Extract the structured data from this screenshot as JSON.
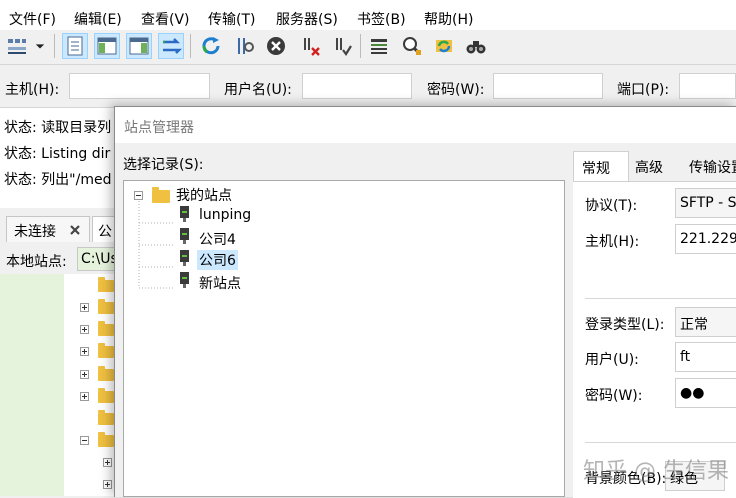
{
  "menu": [
    {
      "label": "文件(F)"
    },
    {
      "label": "编辑(E)"
    },
    {
      "label": "查看(V)"
    },
    {
      "label": "传输(T)"
    },
    {
      "label": "服务器(S)"
    },
    {
      "label": "书签(B)"
    },
    {
      "label": "帮助(H)"
    }
  ],
  "toolbar_icons": [
    "site-manager-icon",
    "dropdown-arrow-icon",
    "toggle-log-icon",
    "toggle-local-tree-icon",
    "toggle-remote-tree-icon",
    "toggle-transfer-queue-icon",
    "refresh-icon",
    "process-queue-icon",
    "cancel-icon",
    "disconnect-icon",
    "reconnect-icon",
    "filter-icon",
    "toggle-compare-icon",
    "search-icon",
    "sync-browse-icon",
    "find-files-icon"
  ],
  "quickconnect": {
    "host_label": "主机(H):",
    "user_label": "用户名(U):",
    "pass_label": "密码(W):",
    "port_label": "端口(P):"
  },
  "log": {
    "lines": [
      "状态:  读取目录列",
      "状态:  Listing dir",
      "状态:  列出\"/med"
    ]
  },
  "tabs": {
    "tab1": "未连接",
    "tab2": "公"
  },
  "local": {
    "label": "本地站点:",
    "path": "C:\\Us"
  },
  "dialog": {
    "title": "站点管理器",
    "select_label": "选择记录(S):",
    "tree_root": "我的站点",
    "sites": [
      "lunping",
      "公司4",
      "公司6",
      "新站点"
    ],
    "tabs": [
      "常规",
      "高级",
      "传输设置"
    ],
    "fields": {
      "protocol_label": "协议(T):",
      "protocol_value": "SFTP - S",
      "host_label": "主机(H):",
      "host_value": "221.229",
      "logontype_label": "登录类型(L):",
      "logontype_value": "正常",
      "user_label": "用户(U):",
      "user_value": "ft",
      "password_label": "密码(W):",
      "password_value": "●●",
      "bg_label": "背景颜色(B):",
      "bg_value": "绿色"
    }
  },
  "watermark": "知乎 @ 生信果",
  "colors": {
    "selection": "#cce8ff",
    "folder": "#f0c040",
    "local_tree_bg": "#e6f3dc"
  }
}
